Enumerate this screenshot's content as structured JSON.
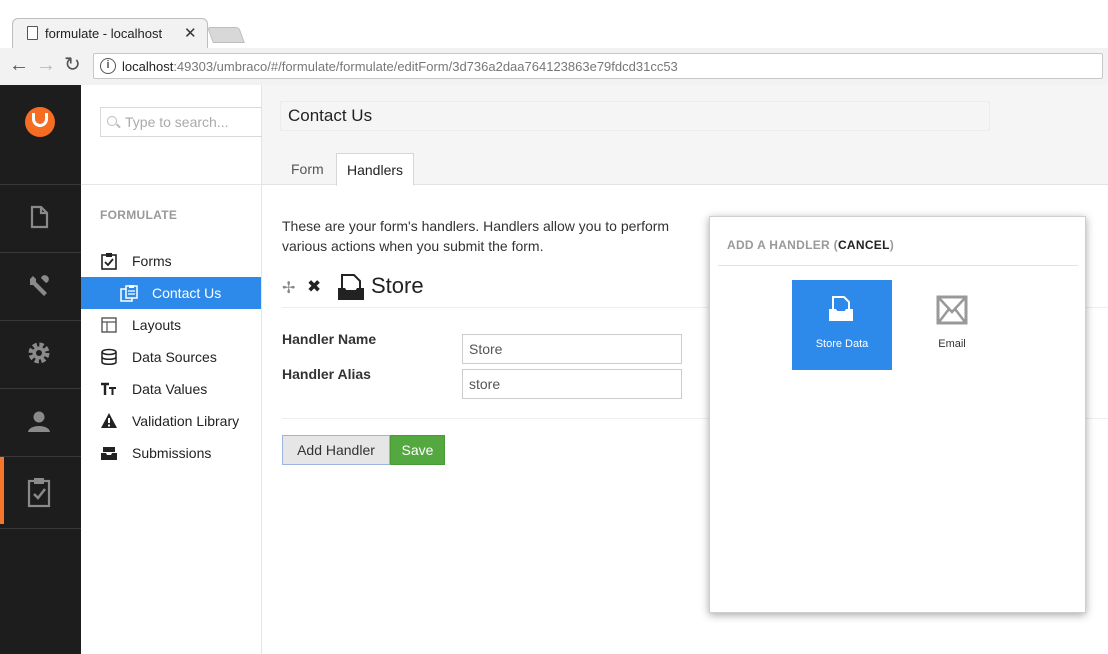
{
  "browser": {
    "tab_title": "formulate - localhost",
    "tab_close": "✕",
    "url_host": "localhost",
    "url_rest": ":49303/umbraco/#/formulate/formulate/editForm/3d736a2daa764123863e79fdcd31cc53",
    "nav_back": "←",
    "nav_forward": "→",
    "nav_reload": "↻",
    "info_glyph": "i"
  },
  "colors": {
    "accent": "#2e8aea",
    "save": "#53a93f",
    "logo": "#f56c23",
    "rail": "#1d1d1d"
  },
  "sidebar": {
    "search_placeholder": "Type to search...",
    "section_title": "FORMULATE",
    "items": [
      {
        "label": "Forms",
        "icon": "clipboard-check-icon"
      },
      {
        "label": "Contact Us",
        "icon": "form-copy-icon",
        "selected": true
      },
      {
        "label": "Layouts",
        "icon": "layout-icon"
      },
      {
        "label": "Data Sources",
        "icon": "database-icon"
      },
      {
        "label": "Data Values",
        "icon": "text-size-icon"
      },
      {
        "label": "Validation Library",
        "icon": "warning-icon"
      },
      {
        "label": "Submissions",
        "icon": "inbox-icon"
      }
    ]
  },
  "rail": {
    "items": [
      "content-icon",
      "developer-wrench-icon",
      "settings-gear-icon",
      "members-user-icon",
      "forms-clipboard-icon"
    ]
  },
  "editor": {
    "form_name": "Contact Us",
    "tabs": [
      {
        "label": "Form"
      },
      {
        "label": "Handlers",
        "active": true
      }
    ],
    "intro": "These are your form's handlers. Handlers allow you to perform various actions when you submit the form.",
    "handler": {
      "move_glyph": "✢",
      "delete_glyph": "✖",
      "title": "Store",
      "name_label": "Handler Name",
      "name_value": "Store",
      "alias_label": "Handler Alias",
      "alias_value": "store"
    },
    "add_handler_label": "Add Handler",
    "save_label": "Save"
  },
  "dialog": {
    "title_prefix": "ADD A HANDLER (",
    "cancel_label": "CANCEL",
    "title_suffix": ")",
    "choices": [
      {
        "label": "Store Data",
        "icon": "store-data-icon",
        "selected": true
      },
      {
        "label": "Email",
        "icon": "email-icon"
      }
    ]
  }
}
